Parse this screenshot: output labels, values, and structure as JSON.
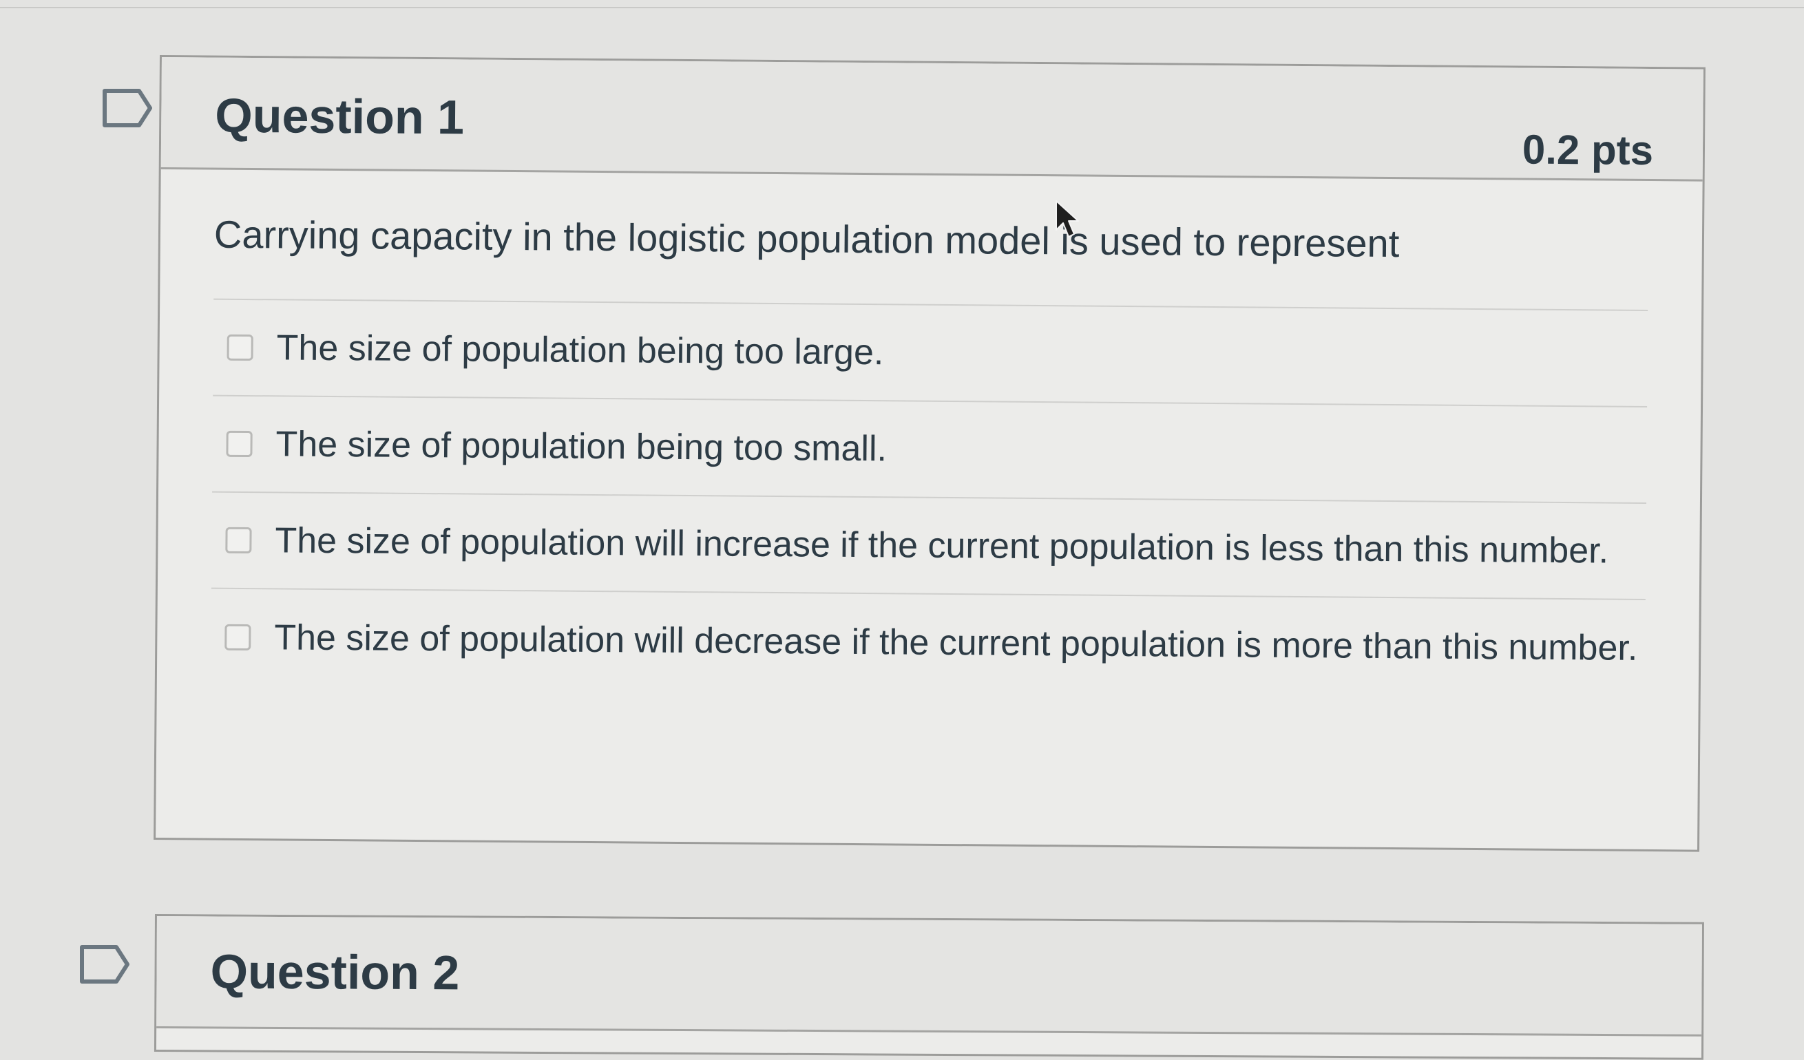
{
  "questions": [
    {
      "title": "Question 1",
      "points": "0.2 pts",
      "text": "Carrying capacity in the logistic population model is used to represent",
      "answers": [
        {
          "label": "The size of population being too large."
        },
        {
          "label": "The size of population being too small."
        },
        {
          "label": "The size of population will increase if the current population is less than this number."
        },
        {
          "label": "The size of population will decrease if the current population is more than this number."
        }
      ]
    },
    {
      "title": "Question 2"
    }
  ],
  "icons": {
    "flag": "flag-outline-icon",
    "cursor": "mouse-pointer-icon"
  }
}
